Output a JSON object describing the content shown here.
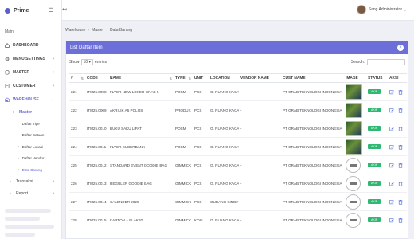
{
  "app": {
    "name": "Prime"
  },
  "topbar": {
    "user_name": "Sang Administrator"
  },
  "sidebar": {
    "section_label": "Main",
    "items": [
      {
        "label": "DASHBOARD",
        "icon": "home-icon"
      },
      {
        "label": "MENU SETTINGS",
        "icon": "gear-icon"
      },
      {
        "label": "MASTER",
        "icon": "database-icon"
      },
      {
        "label": "CUSTOMER",
        "icon": "customer-icon"
      },
      {
        "label": "WAREHOUSE",
        "icon": "warehouse-icon"
      }
    ],
    "warehouse_sub": {
      "master_label": "Master",
      "leaves": [
        "Daftar Tipe",
        "Daftar Satuan",
        "Daftar Lokasi",
        "Daftar Vendor",
        "Data Barang"
      ],
      "transaksi_label": "Transaksi",
      "report_label": "Report"
    }
  },
  "breadcrumb": [
    "Warehouse",
    "Master",
    "Data Barang"
  ],
  "card": {
    "title": "List Daftar Item",
    "show_label": "Show",
    "show_value": "10",
    "entries_label": "entries",
    "search_label": "Search:"
  },
  "table": {
    "headers": [
      "#",
      "CODE",
      "NAME",
      "TYPE",
      "UNIT",
      "LOCATION",
      "VENDOR NAME",
      "CUST NAME",
      "IMAGE",
      "STATUS",
      "AKSI"
    ],
    "rows": [
      {
        "no": "221",
        "code": "ITM25.0008",
        "name": "FLYER NEW LOKER GRAB 5",
        "type": "POSM",
        "unit": "PCS",
        "location": "G. RUANG KACA",
        "vendor": "-",
        "cust": "PT GRAB TEKNOLOGI INDONESIA",
        "image": "photo",
        "status": "AKIF"
      },
      {
        "no": "222",
        "code": "ITM25.0009",
        "name": "AKRILIK A5 POLOS",
        "type": "PRODUK",
        "unit": "PCS",
        "location": "G. RUANG KACA",
        "vendor": "-",
        "cust": "PT GRAB TEKNOLOGI INDONESIA",
        "image": "photo",
        "status": "AKIF"
      },
      {
        "no": "223",
        "code": "ITM25.0010",
        "name": "BUKU SAKU LIPAT",
        "type": "POSM",
        "unit": "PCS",
        "location": "G. RUANG KACA",
        "vendor": "-",
        "cust": "PT GRAB TEKNOLOGI INDONESIA",
        "image": "photo",
        "status": "AKIF"
      },
      {
        "no": "224",
        "code": "ITM25.0011",
        "name": "FLYER SUBERBANK",
        "type": "POSM",
        "unit": "PCS",
        "location": "G. RUANG KACA",
        "vendor": "-",
        "cust": "PT GRAB TEKNOLOGI INDONESIA",
        "image": "photo",
        "status": "AKIF"
      },
      {
        "no": "225",
        "code": "ITM25.0012",
        "name": "STANDARD EVENT GOODIE BAG",
        "type": "GIMMICK",
        "unit": "PCS",
        "location": "G. RUANG KACA",
        "vendor": "-",
        "cust": "PT GRAB TEKNOLOGI INDONESIA",
        "image": "logo",
        "status": "AKIF"
      },
      {
        "no": "226",
        "code": "ITM25.0013",
        "name": "REGULER GOODIE BAG",
        "type": "GIMMICK",
        "unit": "PCS",
        "location": "G. RUANG KACA",
        "vendor": "-",
        "cust": "PT GRAB TEKNOLOGI INDONESIA",
        "image": "logo",
        "status": "AKIF"
      },
      {
        "no": "227",
        "code": "ITM25.0014",
        "name": "CALENDER 2025",
        "type": "GIMMICK",
        "unit": "PCS",
        "location": "GUDANG KINDY",
        "vendor": "-",
        "cust": "PT GRAB TEKNOLOGI INDONESIA",
        "image": "logo",
        "status": "AKIF"
      },
      {
        "no": "228",
        "code": "ITM25.0015",
        "name": "KARTON + PLAKAT",
        "type": "GIMMICK",
        "unit": "KOLI",
        "location": "G. RUANG KACA",
        "vendor": "-",
        "cust": "PT GRAB TEKNOLOGI INDONESIA",
        "image": "logo",
        "status": "AKIF"
      }
    ]
  },
  "colors": {
    "accent": "#6c6fd8",
    "status_green": "#2eb872",
    "edit_blue": "#4a6fd8",
    "delete_blue": "#3d5fc9"
  }
}
